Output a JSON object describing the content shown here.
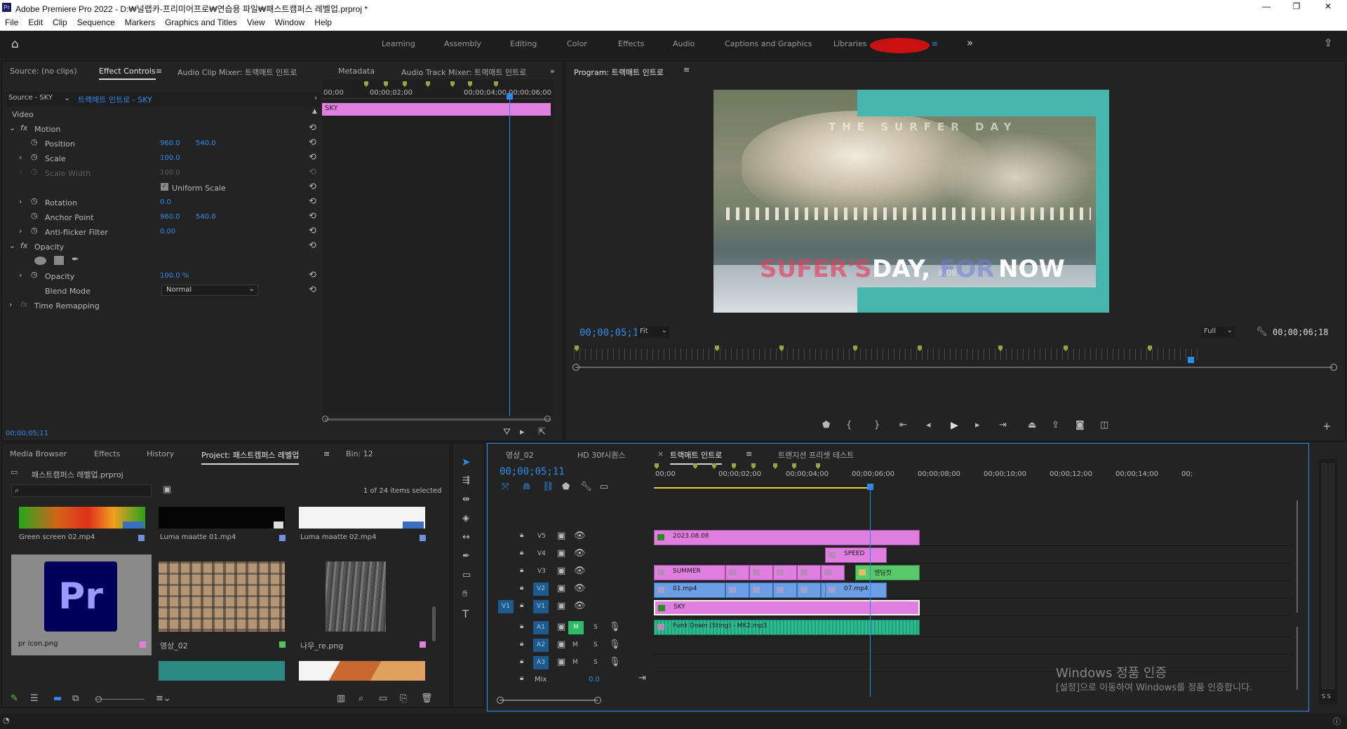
{
  "window": {
    "title": "Adobe Premiere Pro 2022 - D:₩널랩카-프리미어프로₩연습용 파일₩패스트캠퍼스 레벨업.prproj *",
    "app_icon": "Pr",
    "controls": [
      "—",
      "❐",
      "✕"
    ]
  },
  "menu": [
    "File",
    "Edit",
    "Clip",
    "Sequence",
    "Markers",
    "Graphics and Titles",
    "View",
    "Window",
    "Help"
  ],
  "workspaces": [
    "Learning",
    "Assembly",
    "Editing",
    "Color",
    "Effects",
    "Audio",
    "Captions and Graphics",
    "Libraries"
  ],
  "effect_controls": {
    "tabs": [
      "Source: (no clips)",
      "Effect Controls",
      "Audio Clip Mixer: 트랙매트 인트로",
      "Metadata",
      "Audio Track Mixer: 트랙매트 인트로"
    ],
    "source": "Source - SKY",
    "sequence_clip": "트랙매트 인트로 - SKY",
    "video_label": "Video",
    "motion": "Motion",
    "position_label": "Position",
    "position_x": "960.0",
    "position_y": "540.0",
    "scale_label": "Scale",
    "scale": "100.0",
    "scale_width_label": "Scale Width",
    "scale_width": "100.0",
    "uniform_scale": "Uniform Scale",
    "rotation_label": "Rotation",
    "rotation": "0.0",
    "anchor_label": "Anchor Point",
    "anchor_x": "960.0",
    "anchor_y": "540.0",
    "antiflicker_label": "Anti-flicker Filter",
    "antiflicker": "0.00",
    "opacity_group": "Opacity",
    "opacity_label": "Opacity",
    "opacity": "100.0 %",
    "blend_label": "Blend Mode",
    "blend": "Normal",
    "time_remap": "Time Remapping",
    "timecode": "00;00;05;11",
    "ruler": [
      "00;00",
      "00;00;02;00",
      "00;00;04;00",
      "00;00;06;00"
    ],
    "clip_name": "SKY"
  },
  "program": {
    "title": "Program: 트랙매트 인트로",
    "timecode": "00;00;05;11",
    "fit": "Fit",
    "quality": "Full",
    "duration": "00;00;06;18",
    "frame_title": "THE SURFER DAY",
    "frame_words": [
      "SUFER'S",
      "DAY,",
      "FOR",
      "NOW"
    ],
    "frame_date": "8.08"
  },
  "project": {
    "tabs": [
      "Media Browser",
      "Effects",
      "History",
      "Project: 패스트캠퍼스 레벨업",
      "Bin: 12"
    ],
    "file": "패스트캠퍼스 레벨업.prproj",
    "selection": "1 of 24 items selected",
    "items": [
      {
        "name": "Green screen 02.mp4",
        "color": "#6f8fe0"
      },
      {
        "name": "Luma maatte 01.mp4",
        "color": "#6f8fe0"
      },
      {
        "name": "Luma maatte 02.mp4",
        "color": "#6f8fe0"
      },
      {
        "name": "pr icon.png",
        "color": "#e07fe0"
      },
      {
        "name": "영상_02",
        "color": "#55c060"
      },
      {
        "name": "나무_re.png",
        "color": "#e07fe0"
      }
    ]
  },
  "timeline": {
    "tabs": [
      "영상_02",
      "HD 30f시퀀스",
      "트랙매트 인트로",
      "트랜지션 프리셋 테스트"
    ],
    "timecode": "00;00;05;11",
    "ruler": [
      "00;00",
      "00;00;02;00",
      "00;00;04;00",
      "00;00;06;00",
      "00;00;08;00",
      "00;00;10;00",
      "00;00;12;00",
      "00;00;14;00",
      "00;"
    ],
    "video_tracks": [
      "V5",
      "V4",
      "V3",
      "V2",
      "V1"
    ],
    "audio_tracks": [
      "A1",
      "A2",
      "A3"
    ],
    "source_patch": "V1",
    "mix_label": "Mix",
    "mix_value": "0.0",
    "m": "M",
    "s": "S",
    "clips": {
      "v5": "2023.08.08",
      "v4": "SPEED",
      "v3a": "SUMMER",
      "v3b": "엔딩컷",
      "v2a": "01.mp4",
      "v2b": "07.mp4",
      "v1": "SKY",
      "a1": "Funk Down (Sting) - MK2.mp3"
    }
  },
  "watermark": {
    "line1": "Windows 정품 인증",
    "line2": "[설정]으로 이동하여 Windows를 정품 인증합니다."
  },
  "meter": {
    "labels": "S S"
  },
  "fx_label": "fx",
  "colors": {
    "accent": "#2d8ceb",
    "pink_clip": "#e07fe0",
    "blue_clip": "#6c9ee6",
    "green_clip": "#59c96c",
    "audio_clip": "#2dbb8e",
    "playhead": "#2d8ceb"
  }
}
